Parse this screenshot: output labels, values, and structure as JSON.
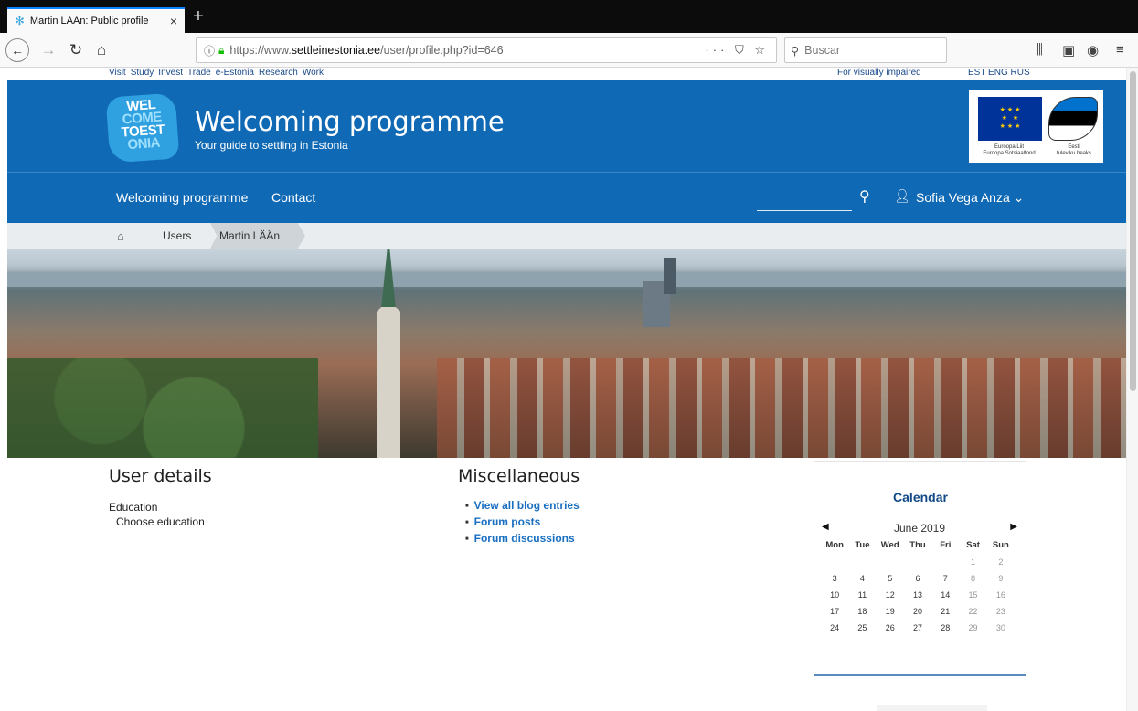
{
  "browser": {
    "tab_title": "Martin LÄÄn: Public profile",
    "tab_close": "×",
    "new_tab": "+",
    "url_prefix": "https://www.",
    "url_domain": "settleinestonia.ee",
    "url_path": "/user/profile.php?id=646",
    "url_actions": "··· ⛉ ☆",
    "search_placeholder": "Buscar",
    "icons": {
      "back": "back-arrow-icon",
      "forward": "forward-arrow-icon",
      "reload": "reload-icon",
      "home": "home-icon",
      "info": "info-icon",
      "lock": "lock-icon",
      "library": "library-icon",
      "sidebar": "sidebar-icon",
      "extension": "extension-icon",
      "menu": "hamburger-menu-icon"
    }
  },
  "top_links": {
    "items": [
      "Visit",
      "Study",
      "Invest",
      "Trade",
      "e-Estonia",
      "Research",
      "Work"
    ],
    "visually_impaired": "For visually impaired",
    "languages": "EST ENG RUS"
  },
  "header": {
    "logo_line1": "WEL",
    "logo_line2": "COME",
    "logo_line3": "TOEST",
    "logo_line4": "ONIA",
    "title": "Welcoming programme",
    "subtitle": "Your guide to settling in Estonia",
    "eu_text1": "Euroopa Liit",
    "eu_text2": "Euroopa Sotsiaalfond",
    "ee_text1": "Eesti",
    "ee_text2": "tuleviku heaks"
  },
  "menu": {
    "item1": "Welcoming programme",
    "item2": "Contact",
    "user_name": "Sofia Vega Anza ⌄"
  },
  "breadcrumb": {
    "users": "Users",
    "current": "Martin LÄÄn"
  },
  "user_details": {
    "heading": "User details",
    "label": "Education",
    "value": "Choose education"
  },
  "misc": {
    "heading": "Miscellaneous",
    "links": [
      "View all blog entries",
      "Forum posts",
      "Forum discussions"
    ]
  },
  "calendar": {
    "title": "Calendar",
    "month": "June 2019",
    "day_headers": [
      "Mon",
      "Tue",
      "Wed",
      "Thu",
      "Fri",
      "Sat",
      "Sun"
    ],
    "weeks": [
      [
        "",
        "",
        "",
        "",
        "",
        "1",
        "2"
      ],
      [
        "3",
        "4",
        "5",
        "6",
        "7",
        "8",
        "9"
      ],
      [
        "10",
        "11",
        "12",
        "13",
        "14",
        "15",
        "16"
      ],
      [
        "17",
        "18",
        "19",
        "20",
        "21",
        "22",
        "23"
      ],
      [
        "24",
        "25",
        "26",
        "27",
        "28",
        "29",
        "30"
      ]
    ]
  },
  "colors": {
    "brand_blue": "#1069b4",
    "link_blue": "#1a6fc0",
    "calendar_title": "#124a86"
  }
}
